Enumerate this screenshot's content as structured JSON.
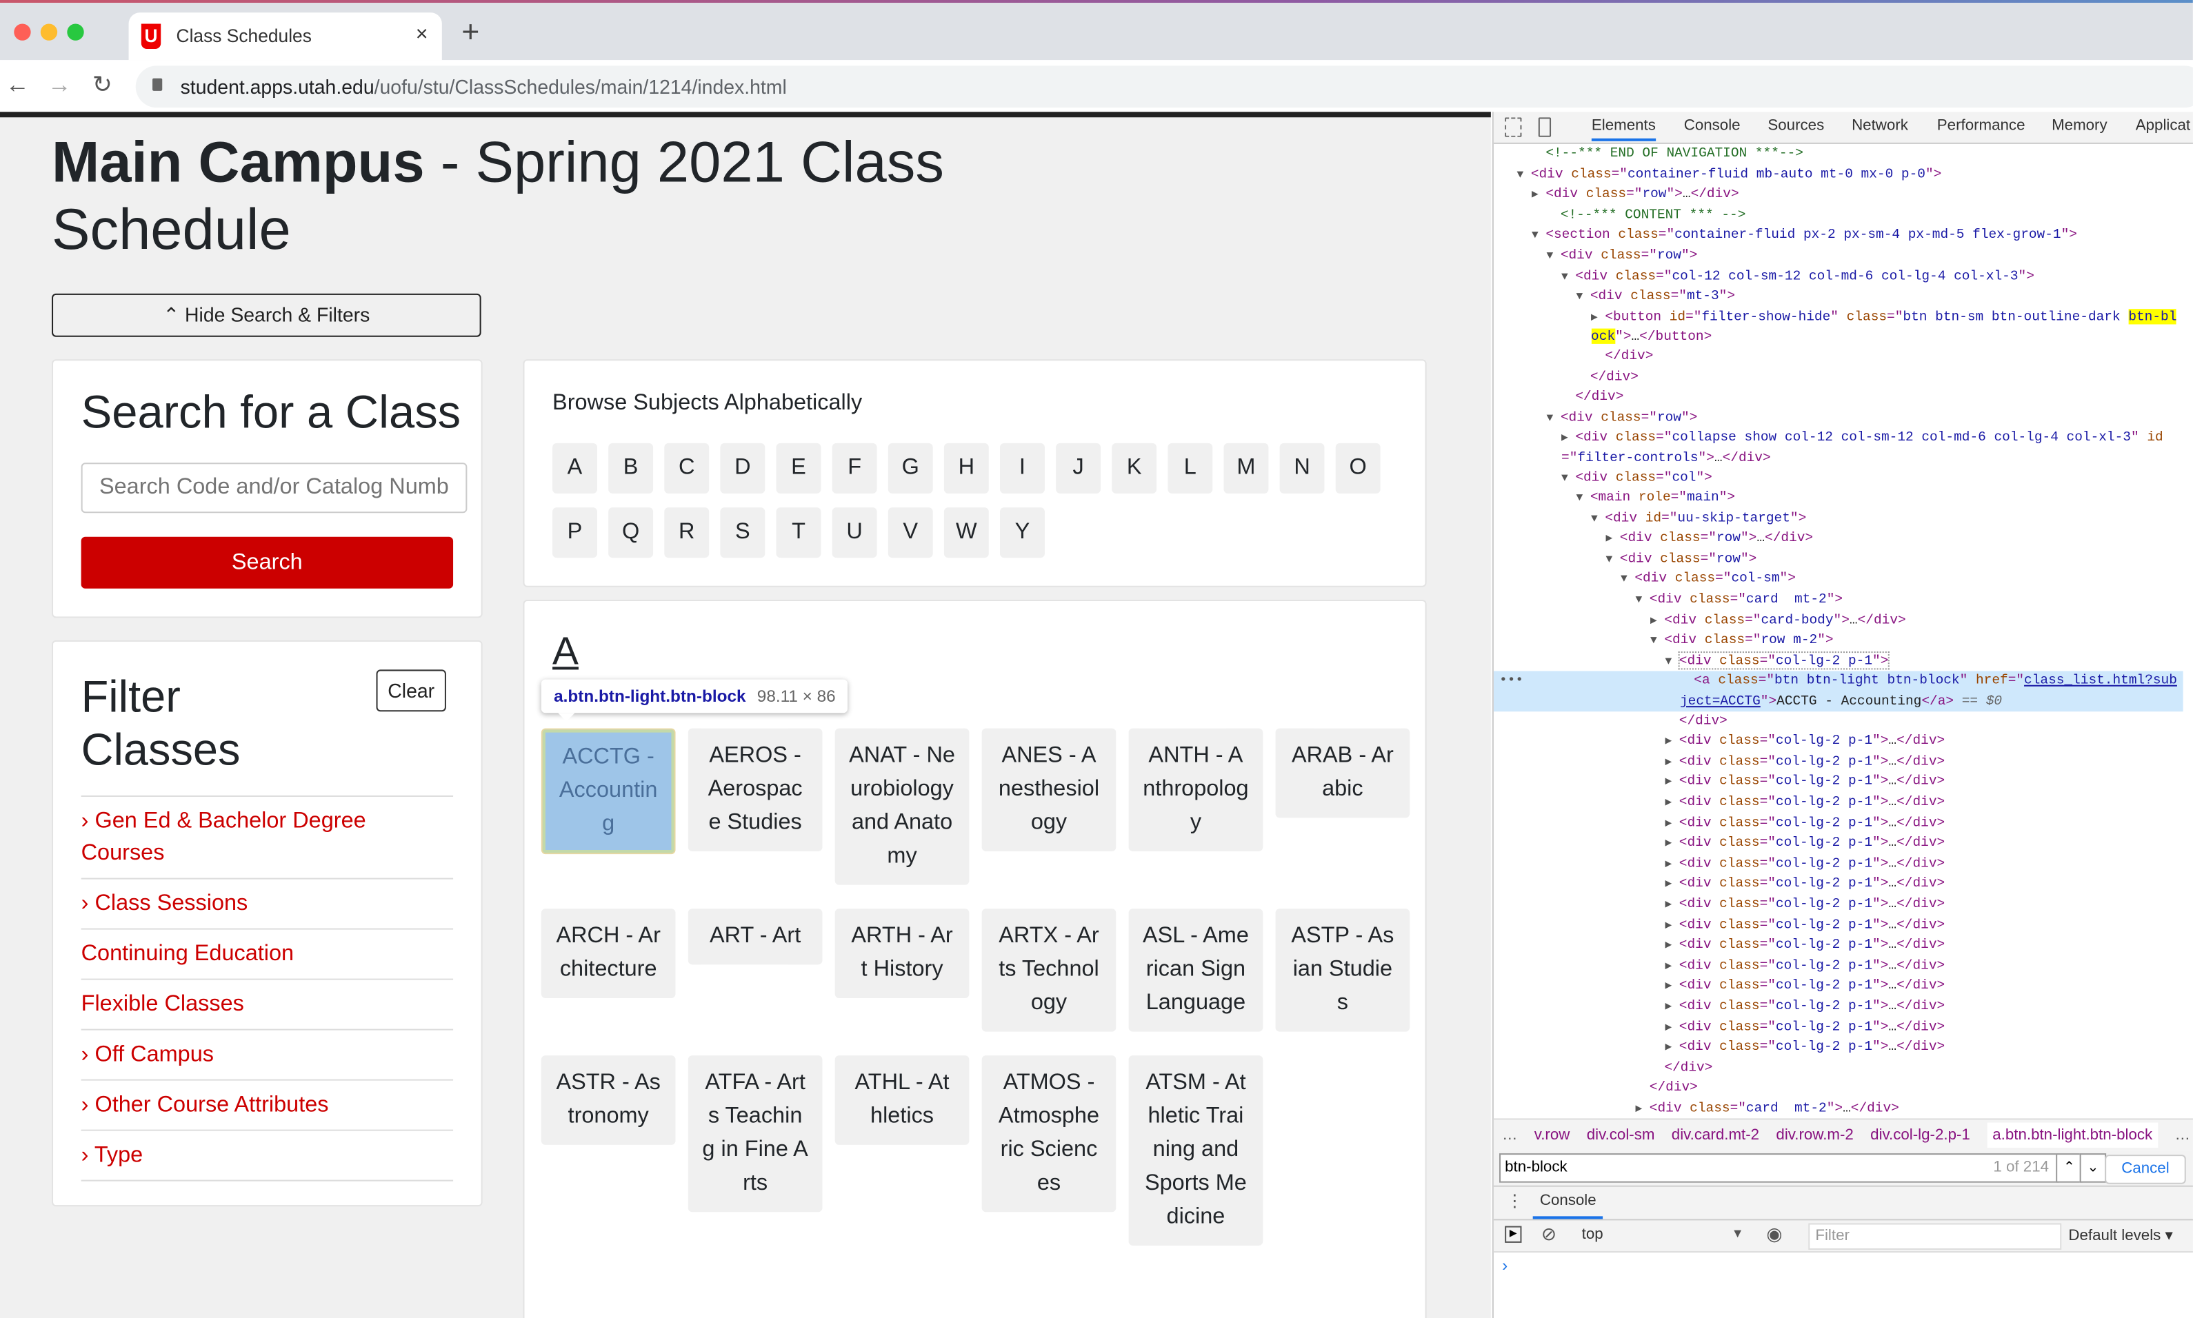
{
  "browser": {
    "tab_title": "Class Schedules",
    "tab_logo": "U",
    "close_glyph": "×",
    "new_tab_glyph": "+",
    "url_host": "student.apps.utah.edu",
    "url_path": "/uofu/stu/ClassSchedules/main/1214/index.html"
  },
  "page": {
    "title_bold": "Main Campus",
    "title_rest": " - Spring 2021 Class Schedule",
    "hide_button": "⌃ Hide Search & Filters",
    "search": {
      "heading": "Search for a Class",
      "placeholder": "Search Code and/or Catalog Number",
      "button": "Search"
    },
    "filter": {
      "heading": "Filter Classes",
      "clear": "Clear",
      "items": [
        {
          "label": "Gen Ed & Bachelor Degree Courses",
          "chevron": true
        },
        {
          "label": "Class Sessions",
          "chevron": true
        },
        {
          "label": "Continuing Education",
          "chevron": false
        },
        {
          "label": "Flexible Classes",
          "chevron": false
        },
        {
          "label": "Off Campus",
          "chevron": true
        },
        {
          "label": "Other Course Attributes",
          "chevron": true
        },
        {
          "label": "Type",
          "chevron": true
        }
      ]
    },
    "browse": {
      "label": "Browse Subjects Alphabetically",
      "letters": [
        "A",
        "B",
        "C",
        "D",
        "E",
        "F",
        "G",
        "H",
        "I",
        "J",
        "K",
        "L",
        "M",
        "N",
        "O",
        "P",
        "Q",
        "R",
        "S",
        "T",
        "U",
        "V",
        "W",
        "Y"
      ]
    },
    "section_letter": "A",
    "subjects": [
      "ACCTG - Accounting",
      "AEROS - Aerospace Studies",
      "ANAT - Neurobiology and Anatomy",
      "ANES - Anesthesiology",
      "ANTH - Anthropology",
      "ARAB - Arabic",
      "ARCH - Architecture",
      "ART - Art",
      "ARTH - Art History",
      "ARTX - Arts Technology",
      "ASL - American Sign Language",
      "ASTP - Asian Studies",
      "ASTR - Astronomy",
      "ATFA - Arts Teaching in Fine Arts",
      "ATHL - Athletics",
      "ATMOS - Atmospheric Sciences",
      "ATSM - Athletic Training and Sports Medicine"
    ],
    "tooltip": {
      "selector": "a.btn.btn-light.btn-block",
      "size": "98.11 × 86"
    }
  },
  "devtools": {
    "tabs": [
      "Elements",
      "Console",
      "Sources",
      "Network",
      "Performance",
      "Memory",
      "Applicat"
    ],
    "active_tab": "Elements",
    "tree": [
      {
        "i": 2,
        "comment": "<!--*** END OF NAVIGATION ***-->"
      },
      {
        "i": 1,
        "arrow": "open",
        "tag": "div",
        "attrs": [
          [
            "class",
            "container-fluid mb-auto mt-0 mx-0 p-0"
          ]
        ]
      },
      {
        "i": 2,
        "arrow": "closed",
        "tag": "div",
        "attrs": [
          [
            "class",
            "row"
          ]
        ],
        "collapsed": true
      },
      {
        "i": 3,
        "comment": "<!--*** CONTENT *** -->"
      },
      {
        "i": 2,
        "arrow": "open",
        "tag": "section",
        "attrs": [
          [
            "class",
            "container-fluid px-2 px-sm-4 px-md-5 flex-grow-1"
          ]
        ]
      },
      {
        "i": 3,
        "arrow": "open",
        "tag": "div",
        "attrs": [
          [
            "class",
            "row"
          ]
        ]
      },
      {
        "i": 4,
        "arrow": "open",
        "tag": "div",
        "attrs": [
          [
            "class",
            "col-12 col-sm-12 col-md-6 col-lg-4 col-xl-3"
          ]
        ]
      },
      {
        "i": 5,
        "arrow": "open",
        "tag": "div",
        "attrs": [
          [
            "class",
            "mt-3"
          ]
        ]
      },
      {
        "i": 6,
        "arrow": "closed",
        "tag": "button",
        "attrs": [
          [
            "id",
            "filter-show-hide"
          ],
          [
            "class",
            "btn btn-sm btn-outline-dark btn-block"
          ]
        ],
        "collapsed": true,
        "highlight": "btn-block"
      },
      {
        "i": 6,
        "close": "div"
      },
      {
        "i": 5,
        "close": "div"
      },
      {
        "i": 4,
        "close": "div"
      },
      {
        "i": 3,
        "arrow": "open",
        "tag": "div",
        "attrs": [
          [
            "class",
            "row"
          ]
        ]
      },
      {
        "i": 4,
        "arrow": "closed",
        "tag": "div",
        "attrs": [
          [
            "class",
            "collapse show col-12 col-sm-12 col-md-6 col-lg-4 col-xl-3"
          ],
          [
            "id",
            "filter-controls"
          ]
        ],
        "collapsed": true
      },
      {
        "i": 4,
        "arrow": "open",
        "tag": "div",
        "attrs": [
          [
            "class",
            "col"
          ]
        ]
      },
      {
        "i": 5,
        "arrow": "open",
        "tag": "main",
        "attrs": [
          [
            "role",
            "main"
          ]
        ]
      },
      {
        "i": 6,
        "arrow": "open",
        "tag": "div",
        "attrs": [
          [
            "id",
            "uu-skip-target"
          ]
        ]
      },
      {
        "i": 7,
        "arrow": "closed",
        "tag": "div",
        "attrs": [
          [
            "class",
            "row"
          ]
        ],
        "collapsed": true
      },
      {
        "i": 7,
        "arrow": "open",
        "tag": "div",
        "attrs": [
          [
            "class",
            "row"
          ]
        ]
      },
      {
        "i": 8,
        "arrow": "open",
        "tag": "div",
        "attrs": [
          [
            "class",
            "col-sm"
          ]
        ]
      },
      {
        "i": 9,
        "arrow": "open",
        "tag": "div",
        "attrs": [
          [
            "class",
            "card  mt-2"
          ]
        ]
      },
      {
        "i": 10,
        "arrow": "closed",
        "tag": "div",
        "attrs": [
          [
            "class",
            "card-body"
          ]
        ],
        "collapsed": true
      },
      {
        "i": 10,
        "arrow": "open",
        "tag": "div",
        "attrs": [
          [
            "class",
            "row m-2"
          ]
        ]
      },
      {
        "i": 11,
        "arrow": "open",
        "tag": "div",
        "attrs": [
          [
            "class",
            "col-lg-2 p-1"
          ]
        ],
        "dotted": true
      },
      {
        "i": 12,
        "tag": "a",
        "attrs": [
          [
            "class",
            "btn btn-light btn-block"
          ],
          [
            "href",
            "class_list.html?subject=ACCTG"
          ]
        ],
        "text": "ACCTG - Accounting",
        "selected": true,
        "suffix": " == $0",
        "link": "href"
      },
      {
        "i": 11,
        "close": "div"
      },
      {
        "i": 11,
        "arrow": "closed",
        "tag": "div",
        "attrs": [
          [
            "class",
            "col-lg-2 p-1"
          ]
        ],
        "collapsed": true
      },
      {
        "i": 11,
        "arrow": "closed",
        "tag": "div",
        "attrs": [
          [
            "class",
            "col-lg-2 p-1"
          ]
        ],
        "collapsed": true
      },
      {
        "i": 11,
        "arrow": "closed",
        "tag": "div",
        "attrs": [
          [
            "class",
            "col-lg-2 p-1"
          ]
        ],
        "collapsed": true
      },
      {
        "i": 11,
        "arrow": "closed",
        "tag": "div",
        "attrs": [
          [
            "class",
            "col-lg-2 p-1"
          ]
        ],
        "collapsed": true
      },
      {
        "i": 11,
        "arrow": "closed",
        "tag": "div",
        "attrs": [
          [
            "class",
            "col-lg-2 p-1"
          ]
        ],
        "collapsed": true
      },
      {
        "i": 11,
        "arrow": "closed",
        "tag": "div",
        "attrs": [
          [
            "class",
            "col-lg-2 p-1"
          ]
        ],
        "collapsed": true
      },
      {
        "i": 11,
        "arrow": "closed",
        "tag": "div",
        "attrs": [
          [
            "class",
            "col-lg-2 p-1"
          ]
        ],
        "collapsed": true
      },
      {
        "i": 11,
        "arrow": "closed",
        "tag": "div",
        "attrs": [
          [
            "class",
            "col-lg-2 p-1"
          ]
        ],
        "collapsed": true
      },
      {
        "i": 11,
        "arrow": "closed",
        "tag": "div",
        "attrs": [
          [
            "class",
            "col-lg-2 p-1"
          ]
        ],
        "collapsed": true
      },
      {
        "i": 11,
        "arrow": "closed",
        "tag": "div",
        "attrs": [
          [
            "class",
            "col-lg-2 p-1"
          ]
        ],
        "collapsed": true
      },
      {
        "i": 11,
        "arrow": "closed",
        "tag": "div",
        "attrs": [
          [
            "class",
            "col-lg-2 p-1"
          ]
        ],
        "collapsed": true
      },
      {
        "i": 11,
        "arrow": "closed",
        "tag": "div",
        "attrs": [
          [
            "class",
            "col-lg-2 p-1"
          ]
        ],
        "collapsed": true
      },
      {
        "i": 11,
        "arrow": "closed",
        "tag": "div",
        "attrs": [
          [
            "class",
            "col-lg-2 p-1"
          ]
        ],
        "collapsed": true
      },
      {
        "i": 11,
        "arrow": "closed",
        "tag": "div",
        "attrs": [
          [
            "class",
            "col-lg-2 p-1"
          ]
        ],
        "collapsed": true
      },
      {
        "i": 11,
        "arrow": "closed",
        "tag": "div",
        "attrs": [
          [
            "class",
            "col-lg-2 p-1"
          ]
        ],
        "collapsed": true
      },
      {
        "i": 11,
        "arrow": "closed",
        "tag": "div",
        "attrs": [
          [
            "class",
            "col-lg-2 p-1"
          ]
        ],
        "collapsed": true
      },
      {
        "i": 10,
        "close": "div"
      },
      {
        "i": 9,
        "close": "div"
      },
      {
        "i": 9,
        "arrow": "closed",
        "tag": "div",
        "attrs": [
          [
            "class",
            "card  mt-2"
          ]
        ],
        "collapsed": true
      },
      {
        "i": 9,
        "arrow": "closed",
        "tag": "div",
        "attrs": [
          [
            "class",
            "card  mt-2"
          ]
        ],
        "collapsed": true
      },
      {
        "i": 9,
        "arrow": "closed",
        "tag": "div",
        "attrs": [
          [
            "class",
            "card  mt-2"
          ]
        ],
        "collapsed": true
      },
      {
        "i": 9,
        "arrow": "closed",
        "tag": "div",
        "attrs": [
          [
            "class",
            "card  mt-2"
          ]
        ],
        "collapsed": true
      }
    ],
    "breadcrumbs": [
      "…",
      "v.row",
      "div.col-sm",
      "div.card.mt-2",
      "div.row.m-2",
      "div.col-lg-2.p-1",
      "a.btn.btn-light.btn-block",
      "…"
    ],
    "find": {
      "value": "btn-block",
      "count": "1 of 214",
      "cancel": "Cancel"
    },
    "drawer_tab": "Console",
    "console": {
      "context": "top",
      "filter_placeholder": "Filter",
      "levels": "Default levels ▾",
      "prompt": "›"
    }
  }
}
